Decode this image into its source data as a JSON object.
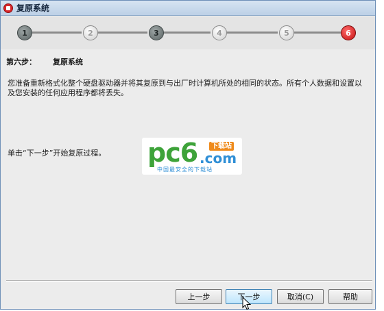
{
  "window": {
    "title": "复原系统",
    "accent_color": "#d9262a"
  },
  "stepper": {
    "current_step": 6,
    "steps": [
      {
        "label": "1",
        "state": "done"
      },
      {
        "label": "2",
        "state": "todo"
      },
      {
        "label": "3",
        "state": "done"
      },
      {
        "label": "4",
        "state": "todo"
      },
      {
        "label": "5",
        "state": "todo"
      },
      {
        "label": "6",
        "state": "current"
      }
    ]
  },
  "content": {
    "step_label": "第六步：",
    "step_title": "复原系统",
    "description": "您准备重新格式化整个硬盘驱动器并将其复原到与出厂时计算机所处的相同的状态。所有个人数据和设置以及您安装的任何应用程序都将丢失。",
    "instruction": "单击“下一步”开始复原过程。"
  },
  "watermark": {
    "logo": "pc6",
    "domain": ".com",
    "badge": "下载站",
    "tagline": "中国最安全的下载站"
  },
  "buttons": {
    "prev": "上一步",
    "next": "下一步",
    "cancel": "取消(C)",
    "help": "帮助"
  }
}
